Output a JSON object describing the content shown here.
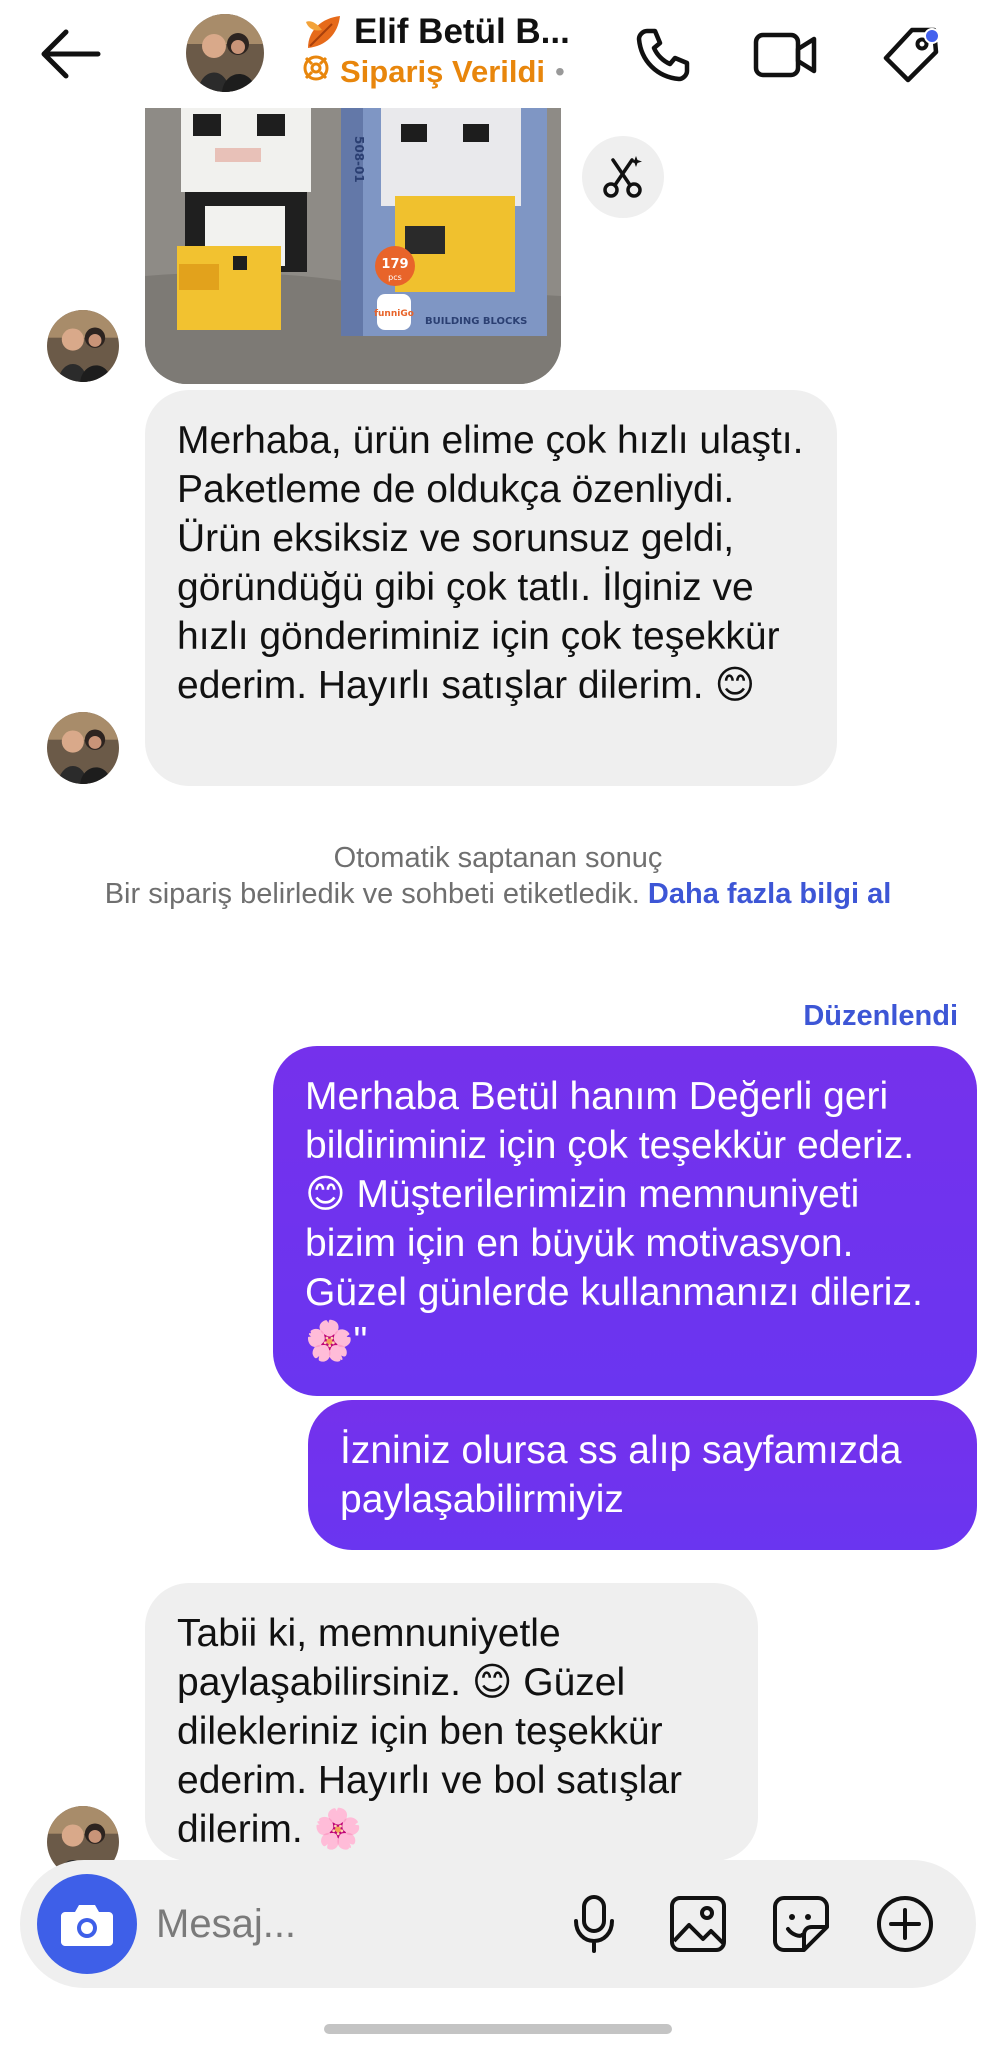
{
  "header": {
    "name": "Elif Betül B...",
    "status": "Sipariş Verildi",
    "status_dot": "•",
    "icons": [
      "back-arrow-icon",
      "avatar",
      "leaf-icon",
      "order-icon",
      "phone-icon",
      "video-icon",
      "tag-icon"
    ]
  },
  "messages": {
    "msg1": "Merhaba, ürün elime çok hızlı ulaştı. Paketleme de oldukça özenliydi. Ürün eksiksiz ve sorunsuz geldi, göründüğü gibi çok tatlı. İlginiz ve hızlı gönderiminiz için çok teşekkür ederim. Hayırlı satışlar dilerim. 😊",
    "msg2": "Merhaba Betül hanım Değerli geri bildiriminiz için çok teşekkür ederiz. 😊 Müşterilerimizin memnuniyeti bizim için en büyük motivasyon. Güzel günlerde kullanmanızı dileriz. 🌸\"",
    "msg3": "İzniniz olursa ss alıp sayfamızda paylaşabilirmiyiz",
    "msg4": "Tabii ki, memnuniyetle paylaşabilirsiniz. 😊 Güzel dilekleriniz için ben teşekkür ederim. Hayırlı ve bol satışlar dilerim. 🌸"
  },
  "photo": {
    "box_code": "508-01",
    "pcs_count": "179",
    "pcs_unit": "pcs",
    "brand": "funniGo",
    "caption": "BUILDING BLOCKS"
  },
  "system_notice": {
    "line1": "Otomatik saptanan sonuç",
    "line2": "Bir sipariş belirledik ve sohbeti etiketledik.",
    "link": "Daha fazla bilgi al"
  },
  "edited_label": "Düzenlendi",
  "composer": {
    "placeholder": "Mesaj...",
    "icons": [
      "camera-icon",
      "microphone-icon",
      "gallery-icon",
      "sticker-icon",
      "plus-circle-icon"
    ]
  },
  "colors": {
    "outgoing_bubble": "#6b2ff0",
    "incoming_bubble": "#efefef",
    "link": "#3d56d6",
    "status_orange": "#e8860c",
    "camera_button": "#3e5fe8"
  }
}
